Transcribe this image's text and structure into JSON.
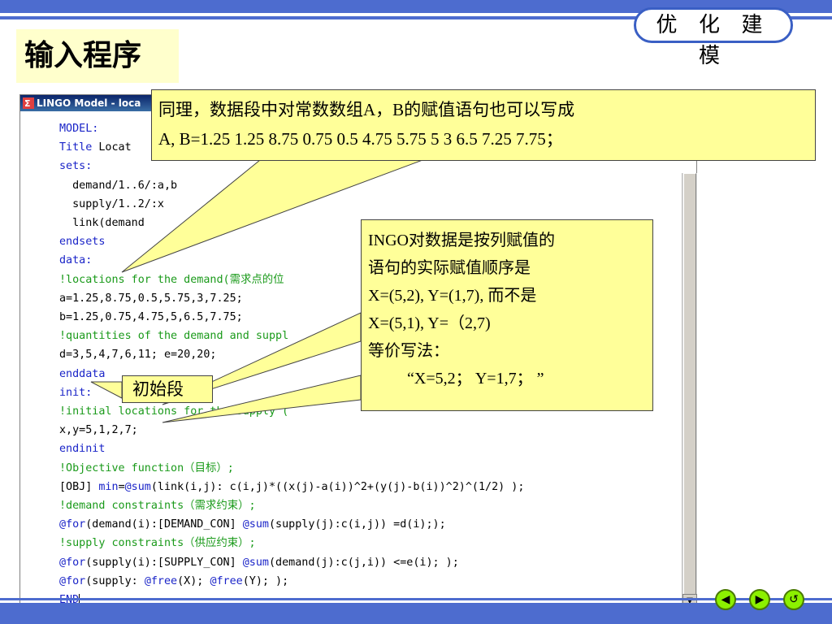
{
  "slide": {
    "badge": "优 化 建 模",
    "heading": "输入程序"
  },
  "window": {
    "title": "LINGO Model - loca"
  },
  "code_lines": [
    "MODEL:",
    "Title Locat",
    "sets:",
    "  demand/1..6/:a,b",
    "  supply/1..2/:x",
    "  link(demand",
    "endsets",
    "data:",
    "!locations for the demand(需求点的位",
    "a=1.25,8.75,0.5,5.75,3,7.25;",
    "b=1.25,0.75,4.75,5,6.5,7.75;",
    "!quantities of the demand and suppl",
    "d=3,5,4,7,6,11; e=20,20;",
    "enddata",
    "init:",
    "!initial locations for the supply (",
    "x,y=5,1,2,7;",
    "endinit",
    "!Objective function（目标）;",
    "[OBJ] min=@sum(link(i,j): c(i,j)*((x(j)-a(i))^2+(y(j)-b(i))^2)^(1/2) );",
    "!demand constraints（需求约束）;",
    "@for(demand(i):[DEMAND_CON] @sum(supply(j):c(i,j)) =d(i););",
    "!supply constraints（供应约束）;",
    "@for(supply(i):[SUPPLY_CON] @sum(demand(j):c(j,i)) <=e(i); );",
    "@for(supply: @free(X); @free(Y); );",
    "END"
  ],
  "callouts": {
    "first": {
      "line1": "同理，数据段中对常数数组A，B的赋值语句也可以写成",
      "line2": "A, B=1.25 1.25 8.75 0.75 0.5 4.75 5.75 5 3 6.5 7.25 7.75；"
    },
    "second": {
      "line1": "INGO对数据是按列赋值的",
      "line2": "语句的实际赋值顺序是",
      "line3": "X=(5,2), Y=(1,7), 而不是",
      "line4": "X=(5,1), Y=（2,7)",
      "line5": "等价写法：",
      "line6": "“X=5,2； Y=1,7； ”"
    },
    "third": {
      "text": "初始段"
    }
  },
  "nav": {
    "prev_icon": "◀",
    "next_icon": "▶",
    "return_icon": "↺"
  },
  "colors": {
    "accent": "#4d6ccf",
    "callout_bg": "#ffff99",
    "keyword": "#1a24c8",
    "comment": "#1a9a1a"
  }
}
